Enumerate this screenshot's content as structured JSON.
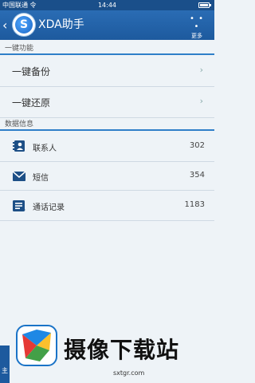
{
  "status_bar": {
    "carrier": "中国联通 令",
    "time": "14:44"
  },
  "header": {
    "title": "XDA助手",
    "more_label": "更多",
    "more_dots": "• • •"
  },
  "sections": [
    {
      "title": "一键功能",
      "items": [
        {
          "label": "一键备份"
        },
        {
          "label": "一键还原"
        }
      ]
    },
    {
      "title": "数据信息",
      "items": [
        {
          "label": "联系人",
          "count": "302"
        },
        {
          "label": "短信",
          "count": "354"
        },
        {
          "label": "通话记录",
          "count": "1183"
        }
      ]
    }
  ],
  "watermark": {
    "brand": "摄像下载站",
    "domain": "sxtgr.com",
    "tab_char": "主"
  },
  "colors": {
    "primary": "#1d5a9e",
    "accent": "#2f7fc8",
    "background": "#eef3f7"
  }
}
